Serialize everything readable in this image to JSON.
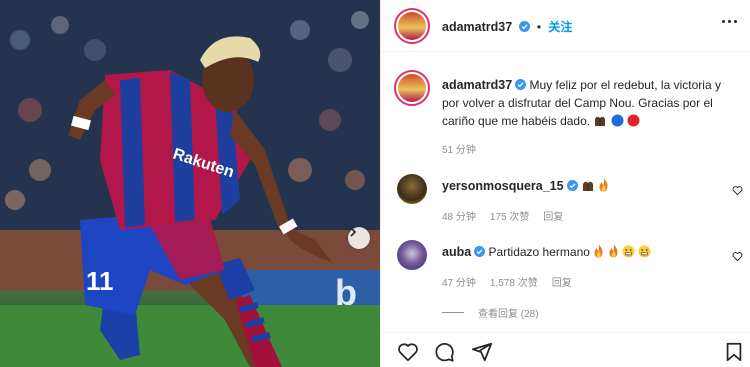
{
  "post": {
    "author": "adamatrd37",
    "follow_label": "关注",
    "separator": "•",
    "caption": "Muy feliz por el redebut, la victoria y por volver a disfrutar del Camp Nou. Gracias por el cariño que me habéis dado.",
    "caption_emojis": [
      "hands-icon",
      "blue-circle-icon",
      "red-circle-icon"
    ],
    "time_ago": "51 分钟"
  },
  "photo": {
    "jersey_number": "11",
    "sponsor": "Rakuten",
    "next_icon": "chevron-right-icon"
  },
  "comments": [
    {
      "username": "yersonmosquera_15",
      "verified": true,
      "text": "",
      "emojis": [
        "hands-icon",
        "fire-icon"
      ],
      "time_ago": "48 分钟",
      "likes": "175 次赞",
      "reply_label": "回复"
    },
    {
      "username": "auba",
      "verified": true,
      "text": "Partidazo hermano",
      "emojis": [
        "fire-icon",
        "fire-icon",
        "grin-icon",
        "grin-icon"
      ],
      "time_ago": "47 分钟",
      "likes": "1,578 次赞",
      "reply_label": "回复"
    }
  ],
  "view_replies": "查看回复 (28)",
  "colors": {
    "accent": "#0095f6",
    "text": "#262626",
    "muted": "#8e8e8e",
    "border": "#efefef",
    "verified": "#3897f0"
  },
  "icons": [
    "heart-icon",
    "comment-icon",
    "share-icon",
    "bookmark-icon",
    "more-icon"
  ]
}
